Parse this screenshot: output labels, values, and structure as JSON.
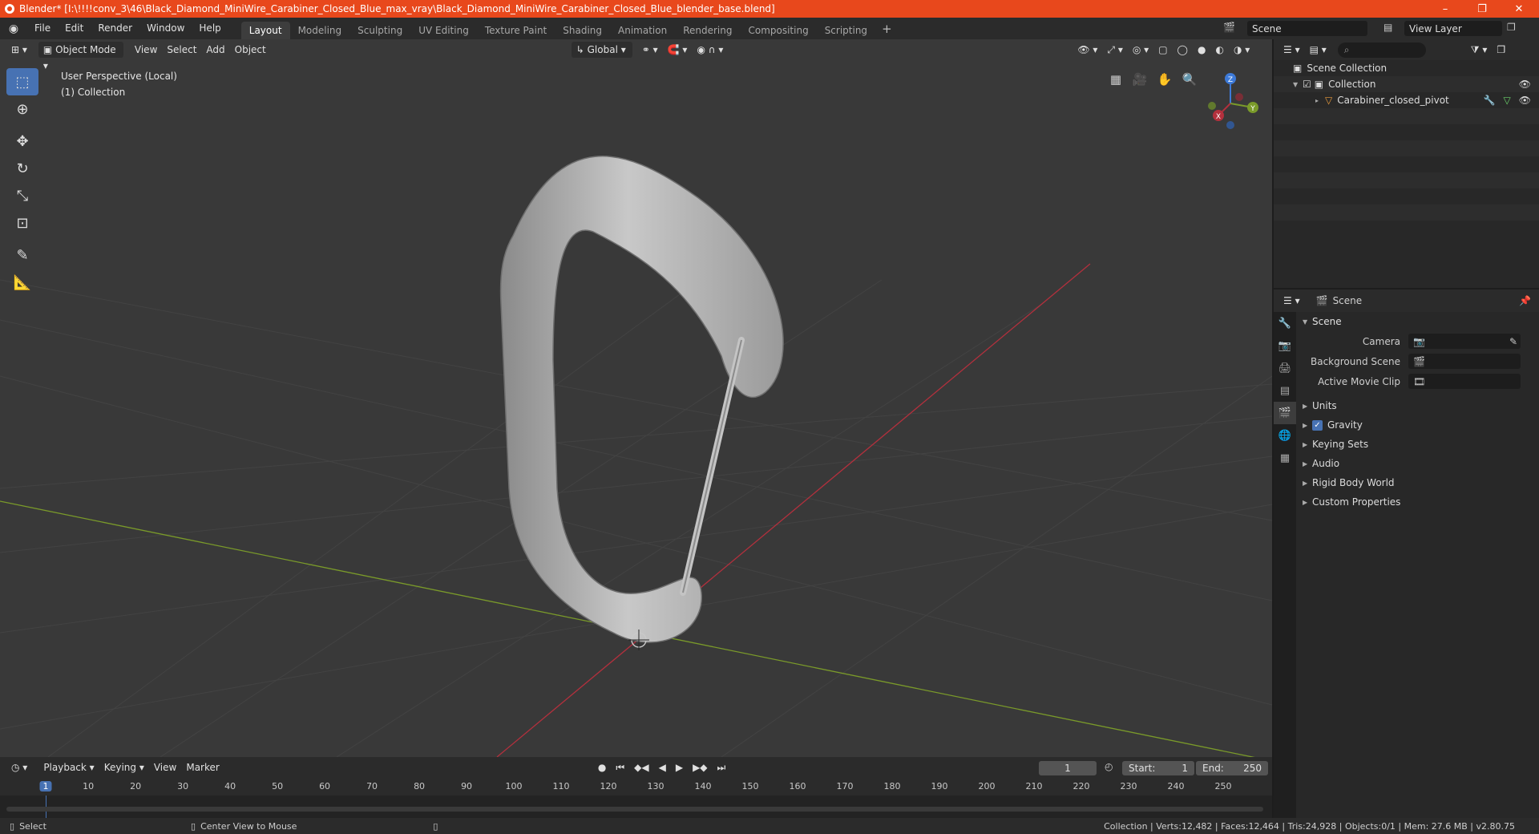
{
  "title_bar": {
    "text": "Blender* [I:\\!!!!conv_3\\46\\Black_Diamond_MiniWire_Carabiner_Closed_Blue_max_vray\\Black_Diamond_MiniWire_Carabiner_Closed_Blue_blender_base.blend]",
    "minimize": "–",
    "maximize": "❐",
    "close": "✕"
  },
  "menu": [
    "File",
    "Edit",
    "Render",
    "Window",
    "Help"
  ],
  "workspaces": [
    "Layout",
    "Modeling",
    "Sculpting",
    "UV Editing",
    "Texture Paint",
    "Shading",
    "Animation",
    "Rendering",
    "Compositing",
    "Scripting"
  ],
  "active_workspace": "Layout",
  "scene_selector": "Scene",
  "view_layer_selector": "View Layer",
  "viewport": {
    "mode": "Object Mode",
    "menus": [
      "View",
      "Select",
      "Add",
      "Object"
    ],
    "orientation": "Global",
    "info_line1": "User Perspective (Local)",
    "info_line2": "(1) Collection",
    "gizmo": {
      "x": "X",
      "y": "Y",
      "z": "Z"
    }
  },
  "timeline": {
    "menus": [
      "Playback",
      "Keying",
      "View",
      "Marker"
    ],
    "current_frame": "1",
    "start_label": "Start:",
    "start": "1",
    "end_label": "End:",
    "end": "250",
    "ticks": [
      "10",
      "20",
      "30",
      "40",
      "50",
      "60",
      "70",
      "80",
      "90",
      "100",
      "110",
      "120",
      "130",
      "140",
      "150",
      "160",
      "170",
      "180",
      "190",
      "200",
      "210",
      "220",
      "230",
      "240",
      "250"
    ],
    "current_tick": "1"
  },
  "outliner": {
    "root": "Scene Collection",
    "collection": "Collection",
    "object": "Carabiner_closed_pivot"
  },
  "properties": {
    "context": "Scene",
    "panel": "Scene",
    "camera_label": "Camera",
    "background_scene_label": "Background Scene",
    "active_movie_clip_label": "Active Movie Clip",
    "subpanels": [
      "Units",
      "Gravity",
      "Keying Sets",
      "Audio",
      "Rigid Body World",
      "Custom Properties"
    ]
  },
  "status": {
    "select": "Select",
    "center_view": "Center View to Mouse",
    "stats": "Collection | Verts:12,482 | Faces:12,464 | Tris:24,928 | Objects:0/1 | Mem: 27.6 MB | v2.80.75"
  },
  "colors": {
    "accent": "#4772b3",
    "title_bar": "#e8481c",
    "x_axis": "#b3303d",
    "y_axis": "#7a9a2a",
    "z_axis": "#3d7ad8"
  }
}
